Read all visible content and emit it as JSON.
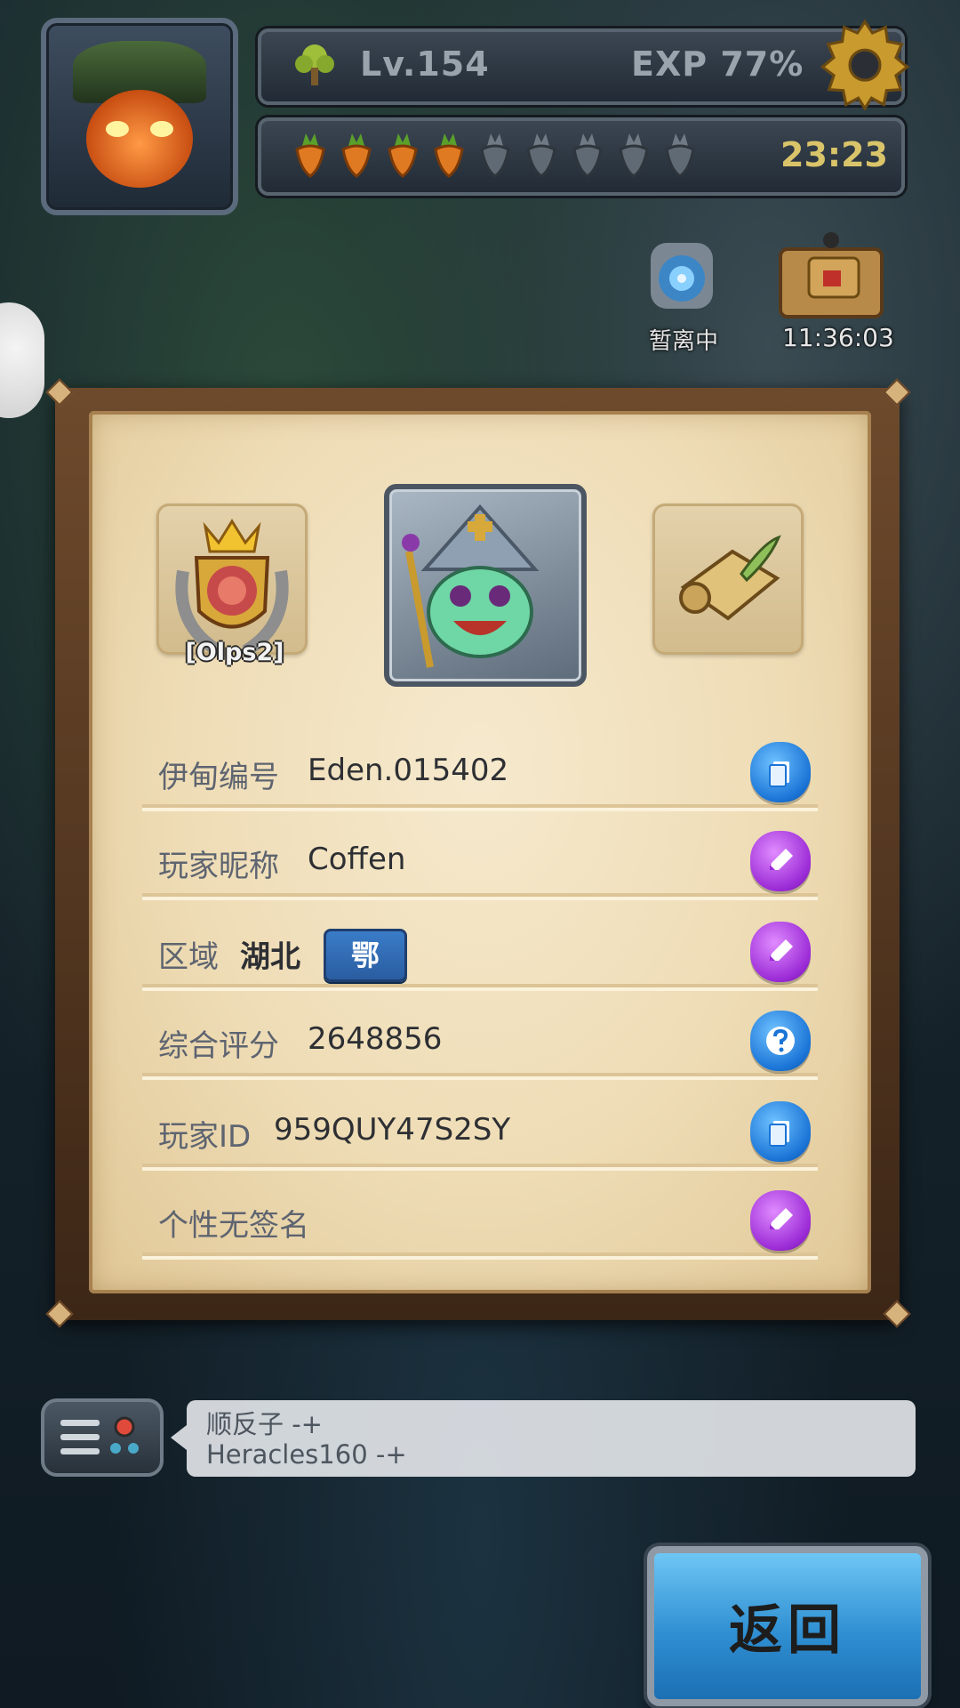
{
  "hud": {
    "level": "Lv.154",
    "exp": "EXP 77%",
    "stamina_timer": "23:23",
    "carrots_filled": 4,
    "carrots_total": 9
  },
  "status": {
    "portal_label": "暂离中",
    "chest_timer": "11:36:03"
  },
  "profile": {
    "guild_tag": "[Olps2]",
    "rows": [
      {
        "label": "伊甸编号",
        "value": "Eden.015402",
        "action": "copy"
      },
      {
        "label": "玩家昵称",
        "value": "Coffen",
        "action": "edit"
      },
      {
        "label": "区域",
        "value": "湖北",
        "badge": "鄂",
        "action": "edit"
      },
      {
        "label": "综合评分",
        "value": "2648856",
        "action": "help"
      },
      {
        "label": "玩家ID",
        "value": "959QUY47S2SY",
        "action": "copy"
      },
      {
        "label": "个性无签名",
        "value": "",
        "action": "edit"
      }
    ]
  },
  "chat": {
    "lines": [
      "顺反子 -+",
      "Heracles160 -+"
    ]
  },
  "return_button": {
    "label": "返回"
  },
  "colors": {
    "copy_seal": "#1a74d6",
    "edit_seal": "#9b2bd6",
    "card_bg": "#eedcb5"
  }
}
